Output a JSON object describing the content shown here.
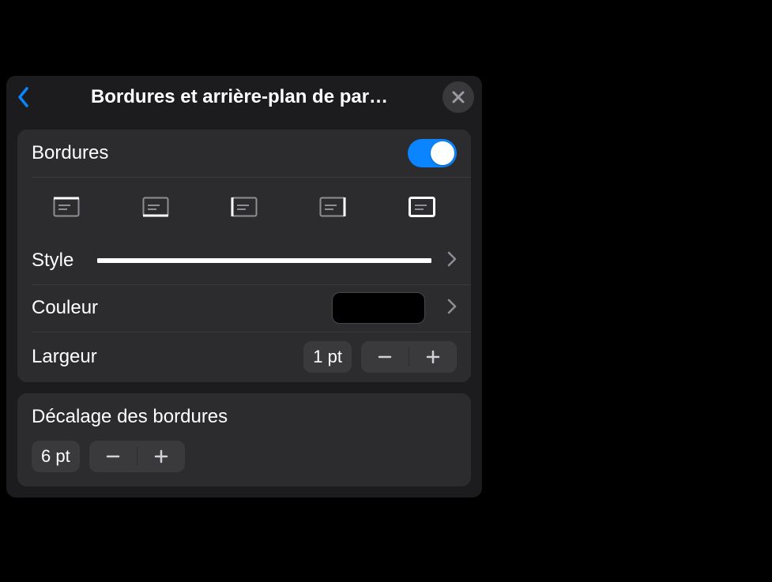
{
  "header": {
    "title": "Bordures et arrière-plan de par…"
  },
  "borders": {
    "label": "Bordures",
    "enabled": true
  },
  "style": {
    "label": "Style"
  },
  "color": {
    "label": "Couleur",
    "value_hex": "#000000"
  },
  "width": {
    "label": "Largeur",
    "value": "1 pt"
  },
  "offset": {
    "label": "Décalage des bordures",
    "value": "6 pt"
  },
  "border_positions": [
    {
      "id": "top",
      "name": "border-top-icon"
    },
    {
      "id": "bottom",
      "name": "border-bottom-icon"
    },
    {
      "id": "left",
      "name": "border-left-icon"
    },
    {
      "id": "right",
      "name": "border-right-icon"
    },
    {
      "id": "all",
      "name": "border-all-icon",
      "selected": true
    }
  ]
}
